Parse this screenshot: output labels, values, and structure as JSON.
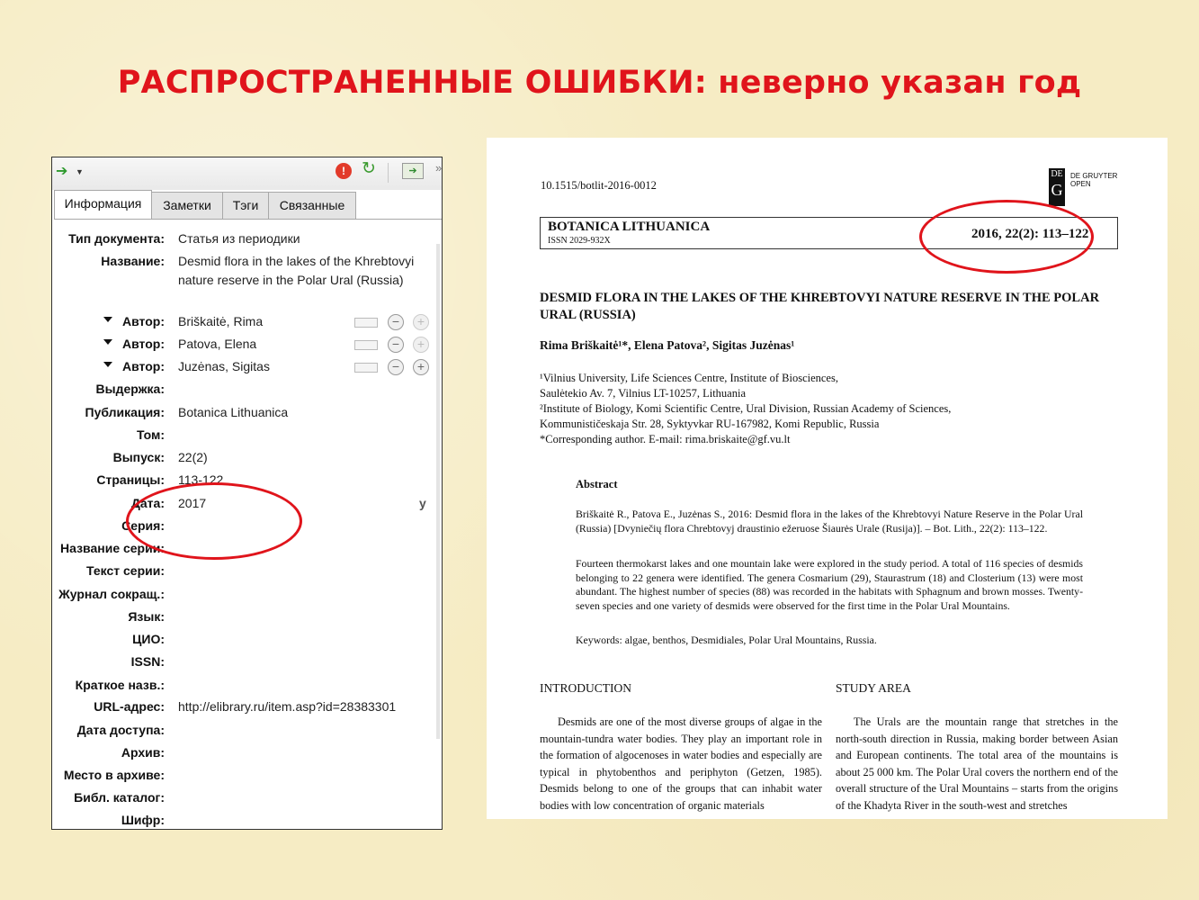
{
  "slide": {
    "title": "РАСПРОСТРАНЕННЫЕ ОШИБКИ: неверно указан год"
  },
  "zotero": {
    "tabs": [
      {
        "label": "Информация",
        "active": true
      },
      {
        "label": "Заметки",
        "active": false
      },
      {
        "label": "Тэги",
        "active": false
      },
      {
        "label": "Связанные",
        "active": false
      }
    ],
    "fields": {
      "type_label": "Тип документа:",
      "type_value": "Статья из периодики",
      "title_label": "Название:",
      "title_value": "Desmid flora in the lakes of the Khrebtovyi nature reserve in the Polar Ural (Russia)",
      "author_label": "Автор:",
      "author1": "Briškaitė, Rima",
      "author2": "Patova, Elena",
      "author3": "Juzėnas, Sigitas",
      "excerpt_label": "Выдержка:",
      "publication_label": "Публикация:",
      "publication_value": "Botanica Lithuanica",
      "volume_label": "Том:",
      "issue_label": "Выпуск:",
      "issue_value": "22(2)",
      "pages_label": "Страницы:",
      "pages_value": "113-122",
      "date_label": "Дата:",
      "date_value": "2017",
      "date_ymd": "y",
      "series_label": "Серия:",
      "series_title_label": "Название серии:",
      "series_text_label": "Текст серии:",
      "journal_abbr_label": "Журнал сокращ.:",
      "language_label": "Язык:",
      "doi_label": "ЦИО:",
      "issn_label": "ISSN:",
      "short_title_label": "Краткое назв.:",
      "url_label": "URL-адрес:",
      "url_value": "http://elibrary.ru/item.asp?id=28383301",
      "accessed_label": "Дата доступа:",
      "archive_label": "Архив:",
      "archive_loc_label": "Место в архиве:",
      "library_catalog_label": "Библ. каталог:",
      "call_number_label": "Шифр:"
    }
  },
  "article": {
    "doi": "10.1515/botlit-2016-0012",
    "publisher_logo_top": "DE",
    "publisher_logo_bottom": "G",
    "publisher_line1": "DE GRUYTER",
    "publisher_line2": "OPEN",
    "journal": "BOTANICA LITHUANICA",
    "issn": "ISSN 2029-932X",
    "citation": "2016, 22(2): 113–122",
    "title": "DESMID FLORA IN THE LAKES OF THE KHREBTOVYI NATURE RESERVE IN THE POLAR URAL (RUSSIA)",
    "authors": "Rima Briškaitė¹*, Elena Patova², Sigitas Juzėnas¹",
    "affiliations": "¹Vilnius University, Life Sciences Centre, Institute of Biosciences,\nSaulėtekio Av. 7, Vilnius LT-10257, Lithuania\n²Institute of Biology, Komi Scientific Centre, Ural Division, Russian Academy of Sciences,\nKommunističeskaja Str. 28, Syktyvkar RU-167982, Komi Republic, Russia\n*Corresponding author. E-mail: rima.briskaite@gf.vu.lt",
    "abstract_heading": "Abstract",
    "abstract_ref": "Briškaitė R., Patova E., Juzėnas S., 2016: Desmid flora in the lakes of the Khrebtovyi Nature Reserve in the Polar Ural (Russia) [Dvyniečių flora Chrebtovyj draustinio ežeruose Šiaurės Urale (Rusija)]. – Bot. Lith., 22(2): 113–122.",
    "abstract_text": "Fourteen thermokarst lakes and one mountain lake were explored in the study period. A total of 116 species of desmids belonging to 22 genera were identified. The genera Cosmarium (29), Staurastrum (18) and Closterium (13) were most abundant. The highest number of species (88) was recorded in the habitats with Sphagnum and brown mosses. Twenty-seven species and one variety of desmids were observed for the first time in the Polar Ural Mountains.",
    "keywords": "Keywords: algae, benthos, Desmidiales, Polar Ural Mountains, Russia.",
    "intro_heading": "INTRODUCTION",
    "study_heading": "STUDY AREA",
    "intro_text": "Desmids are one of the most diverse groups of algae in the mountain-tundra water bodies. They play an important role in the formation of algocenoses in water bodies and especially are typical in phytobenthos and periphyton (Getzen, 1985). Desmids belong to one of the groups that can inhabit water bodies with low concentration of organic materials",
    "study_text": "The Urals are the mountain range that stretches in the north-south direction in Russia, making border between Asian and European continents. The total area of the mountains is about 25 000 km. The Polar Ural covers the northern end of the overall structure of the Ural Mountains – starts from the origins of the Khadyta River in the south-west and stretches"
  },
  "colors": {
    "title_red": "#e0141b",
    "highlight_red": "#e0141b",
    "slide_background": "#f6ecc4"
  }
}
